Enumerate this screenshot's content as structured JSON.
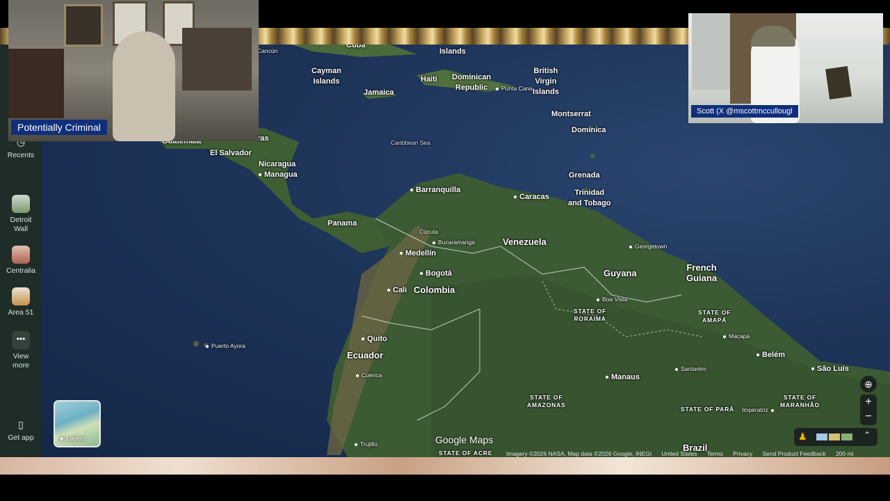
{
  "sidebar": {
    "recents_label": "Recents",
    "saved": [
      {
        "label": "Detroit\nWall",
        "line1": "Detroit",
        "line2": "Wall"
      },
      {
        "label": "Centralia"
      },
      {
        "label": "Area 51"
      }
    ],
    "view_more_line1": "View",
    "view_more_line2": "more",
    "get_app_label": "Get app"
  },
  "layers_label": "Layers",
  "watermark": "Google Maps",
  "attribution": {
    "imagery": "Imagery ©2026 NASA, Map data ©2026 Google, INEGI",
    "region": "United States",
    "terms": "Terms",
    "privacy": "Privacy",
    "feedback": "Send Product Feedback",
    "scale": "200 mi"
  },
  "map_labels": {
    "cancun": "Cancún",
    "cuba": "Cuba",
    "islands": "Islands",
    "cayman_1": "Cayman",
    "cayman_2": "Islands",
    "jamaica": "Jamaica",
    "haiti": "Haiti",
    "dominican_1": "Dominican",
    "dominican_2": "Republic",
    "punta_cana": "Punta Cana",
    "bvi_1": "British",
    "bvi_2": "Virgin",
    "bvi_3": "Islands",
    "montserrat": "Montserrat",
    "dominica": "Dominica",
    "caribbean_sea": "Caribbean Sea",
    "grenada": "Grenada",
    "trinidad_1": "Trinidad",
    "trinidad_2": "and Tobago",
    "guatemala": "Guatemala",
    "el_salvador": "El Salvador",
    "ras": "ras",
    "nicaragua": "Nicaragua",
    "managua": "Managua",
    "panama": "Panama",
    "barranquilla": "Barranquilla",
    "caracas": "Caracas",
    "cucuta": "Cúcuta",
    "bucaramanga": "Bucaramanga",
    "venezuela": "Venezuela",
    "georgetown": "Georgetown",
    "medellin": "Medellín",
    "bogota": "Bogotá",
    "cali": "Cali",
    "colombia": "Colombia",
    "guyana": "Guyana",
    "french_guiana_1": "French",
    "french_guiana_2": "Guiana",
    "boa_vista": "Boa Vista",
    "roraima_1": "STATE OF",
    "roraima_2": "RORAIMA",
    "amapa_1": "STATE OF",
    "amapa_2": "AMAPÁ",
    "macapa": "Macapá",
    "puerto_ayora": "Puerto Ayora",
    "quito": "Quito",
    "ecuador": "Ecuador",
    "cuenca": "Cuenca",
    "manaus": "Manaus",
    "santarem": "Santarém",
    "belem": "Belém",
    "sao_luis": "São Luís",
    "amazonas_1": "STATE OF",
    "amazonas_2": "AMAZONAS",
    "para": "STATE OF PARÁ",
    "imperatriz": "Imperatriz",
    "maranhao_1": "STATE OF",
    "maranhao_2": "MARANHÃO",
    "trujillo": "Trujillo",
    "acre": "STATE OF ACRE",
    "brazil": "Brazil"
  },
  "overlays": {
    "host_tag": "Potentially Criminal",
    "guest_tag": "Scott (X @mscottmccullougl"
  },
  "colors": {
    "ocean": "#1d3358",
    "land": "#3c5a34",
    "sidebar": "#1f2d28",
    "name_tag": "#0f2f7a"
  }
}
